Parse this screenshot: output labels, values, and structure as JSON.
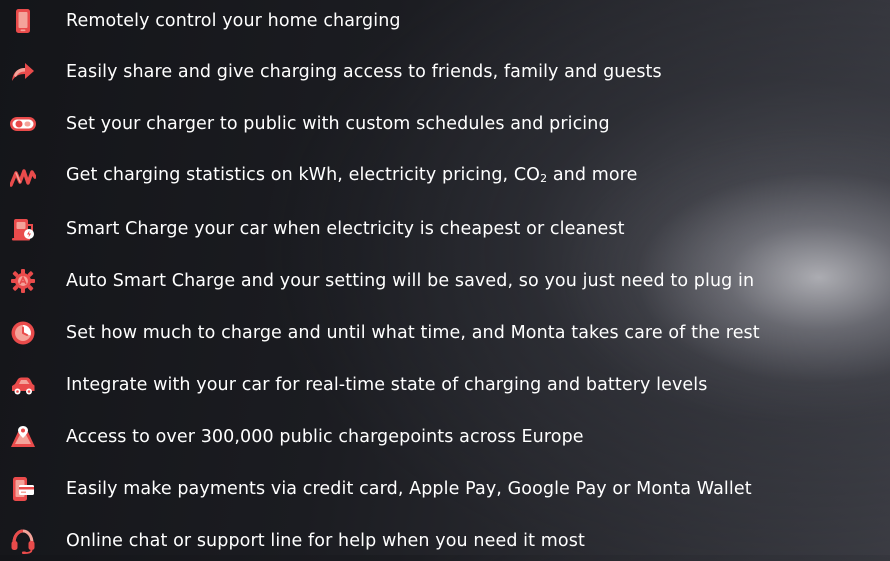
{
  "features": [
    {
      "icon": "phone-icon",
      "text": "Remotely control your home charging"
    },
    {
      "icon": "share-arrow-icon",
      "text": "Easily share and give charging access to friends, family and guests"
    },
    {
      "icon": "toggle-switch-icon",
      "text": "Set your charger to public with custom schedules and pricing"
    },
    {
      "icon": "statistics-graph-icon",
      "text_before": "Get charging statistics on kWh, electricity pricing, CO",
      "text_sub": "2",
      "text_after": " and more"
    },
    {
      "icon": "smart-charge-icon",
      "text": "Smart Charge your car when electricity is cheapest or cleanest"
    },
    {
      "icon": "auto-settings-gear-icon",
      "text": "Auto Smart Charge and your setting will be saved, so you just need to plug in"
    },
    {
      "icon": "clock-timer-icon",
      "text": "Set how much to charge and until what time, and Monta takes care of the rest"
    },
    {
      "icon": "car-icon",
      "text": "Integrate with your car for real-time state of charging and battery levels"
    },
    {
      "icon": "map-pin-icon",
      "text": "Access to over 300,000 public chargepoints across Europe"
    },
    {
      "icon": "payment-card-icon",
      "text": "Easily make payments via credit card, Apple Pay, Google Pay or Monta Wallet"
    },
    {
      "icon": "headset-support-icon",
      "text": "Online chat or support line for help when you need it most"
    }
  ],
  "colors": {
    "icon_primary": "#e94b4b",
    "icon_light": "#f4a39a",
    "text": "#ffffff"
  }
}
